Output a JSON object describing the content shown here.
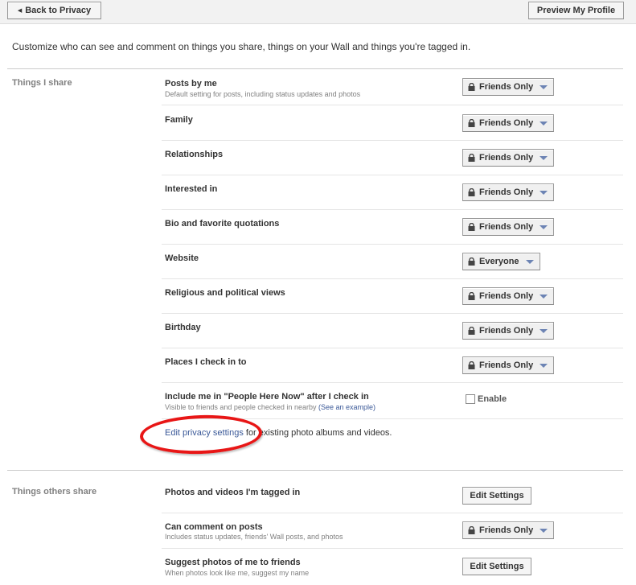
{
  "toolbar": {
    "back_label": "Back to Privacy",
    "preview_label": "Preview My Profile"
  },
  "intro": "Customize who can see and comment on things you share, things on your Wall and things you're tagged in.",
  "sections": {
    "things_i_share": {
      "title": "Things I share",
      "rows": [
        {
          "label": "Posts by me",
          "sub": "Default setting for posts, including status updates and photos",
          "setting": "Friends Only"
        },
        {
          "label": "Family",
          "setting": "Friends Only"
        },
        {
          "label": "Relationships",
          "setting": "Friends Only"
        },
        {
          "label": "Interested in",
          "setting": "Friends Only"
        },
        {
          "label": "Bio and favorite quotations",
          "setting": "Friends Only"
        },
        {
          "label": "Website",
          "setting": "Everyone"
        },
        {
          "label": "Religious and political views",
          "setting": "Friends Only"
        },
        {
          "label": "Birthday",
          "setting": "Friends Only"
        },
        {
          "label": "Places I check in to",
          "setting": "Friends Only"
        },
        {
          "label": "Include me in \"People Here Now\" after I check in",
          "sub": "Visible to friends and people checked in nearby",
          "sub_link": "(See an example)",
          "checkbox_label": "Enable",
          "checked": false
        }
      ],
      "edit_link": "Edit privacy settings",
      "edit_suffix": " for existing photo albums and videos."
    },
    "things_others_share": {
      "title": "Things others share",
      "rows": [
        {
          "label": "Photos and videos I'm tagged in",
          "button": "Edit Settings"
        },
        {
          "label": "Can comment on posts",
          "sub": "Includes status updates, friends' Wall posts, and photos",
          "setting": "Friends Only"
        },
        {
          "label": "Suggest photos of me to friends",
          "sub": "When photos look like me, suggest my name",
          "button": "Edit Settings"
        }
      ]
    }
  },
  "colors": {
    "link": "#3b5998",
    "annotation": "#e81616",
    "caret": "#6d84b4"
  }
}
